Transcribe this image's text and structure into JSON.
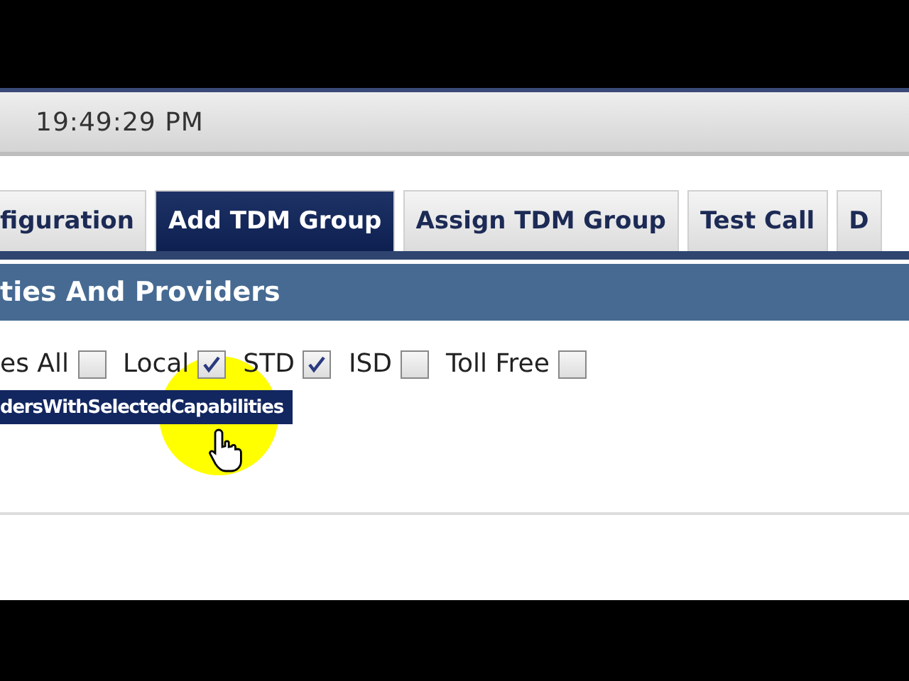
{
  "header": {
    "time": "19:49:29 PM"
  },
  "tabs": [
    {
      "label": "figuration",
      "selected": false
    },
    {
      "label": "Add TDM Group",
      "selected": true
    },
    {
      "label": "Assign TDM Group",
      "selected": false
    },
    {
      "label": "Test Call",
      "selected": false
    },
    {
      "label": "D",
      "selected": false
    }
  ],
  "section": {
    "title": "ties And Providers"
  },
  "capabilities": [
    {
      "label": "es All",
      "checked": false
    },
    {
      "label": "Local",
      "checked": true
    },
    {
      "label": "STD",
      "checked": true
    },
    {
      "label": "ISD",
      "checked": false
    },
    {
      "label": "Toll Free",
      "checked": false
    }
  ],
  "action_button": {
    "label": "dersWithSelectedCapabilities"
  }
}
